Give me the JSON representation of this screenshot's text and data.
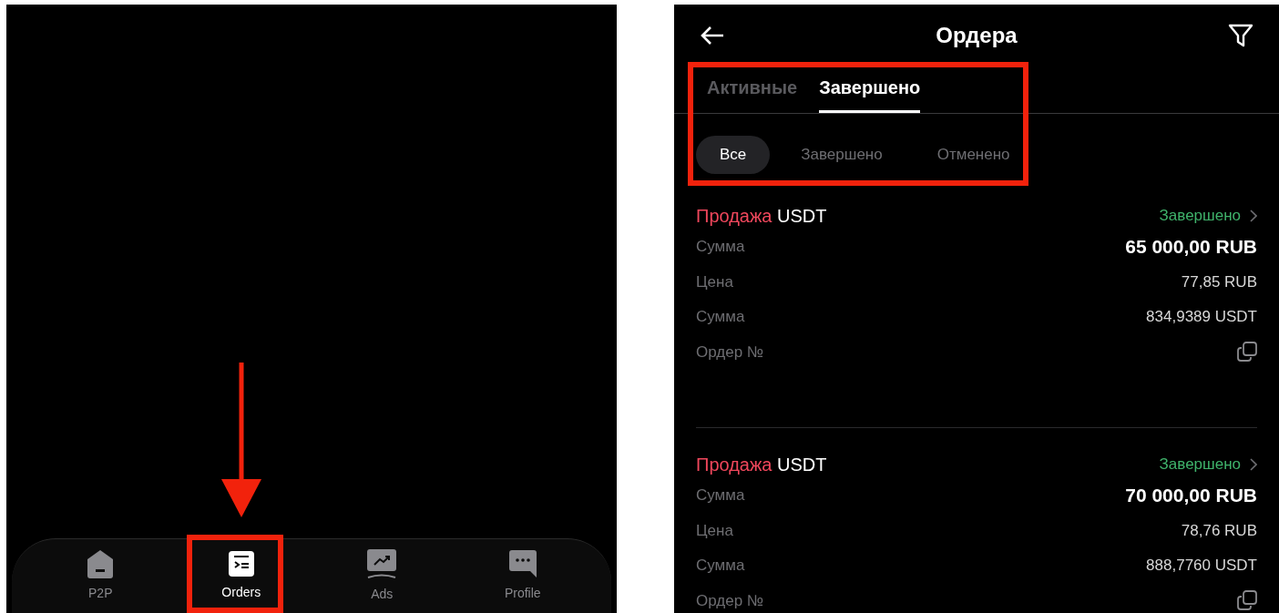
{
  "bottom_nav": {
    "items": [
      {
        "kind": "home",
        "label": "P2P",
        "selected": false
      },
      {
        "kind": "orders",
        "label": "Orders",
        "selected": true
      },
      {
        "kind": "ads",
        "label": "Ads",
        "selected": false
      },
      {
        "kind": "profile",
        "label": "Profile",
        "selected": false
      }
    ]
  },
  "orders_screen": {
    "title": "Ордера",
    "tabs": [
      {
        "label": "Активные",
        "selected": false
      },
      {
        "label": "Завершено",
        "selected": true
      }
    ],
    "filters": [
      {
        "label": "Все",
        "selected": true
      },
      {
        "label": "Завершено",
        "selected": false
      },
      {
        "label": "Отменено",
        "selected": false
      }
    ],
    "orders": [
      {
        "side": "Продажа",
        "asset": "USDT",
        "status": "Завершено",
        "rows": [
          {
            "kind": "amount",
            "label": "Сумма",
            "value": "65 000,00 RUB"
          },
          {
            "kind": "plain",
            "label": "Цена",
            "value": "77,85 RUB"
          },
          {
            "kind": "plain",
            "label": "Сумма",
            "value": "834,9389 USDT"
          },
          {
            "kind": "copy",
            "label": "Ордер №"
          }
        ]
      },
      {
        "side": "Продажа",
        "asset": "USDT",
        "status": "Завершено",
        "rows": [
          {
            "kind": "amount",
            "label": "Сумма",
            "value": "70 000,00 RUB"
          },
          {
            "kind": "plain",
            "label": "Цена",
            "value": "78,76 RUB"
          },
          {
            "kind": "plain",
            "label": "Сумма",
            "value": "888,7760 USDT"
          },
          {
            "kind": "copy",
            "label": "Ордер №"
          }
        ]
      }
    ]
  }
}
